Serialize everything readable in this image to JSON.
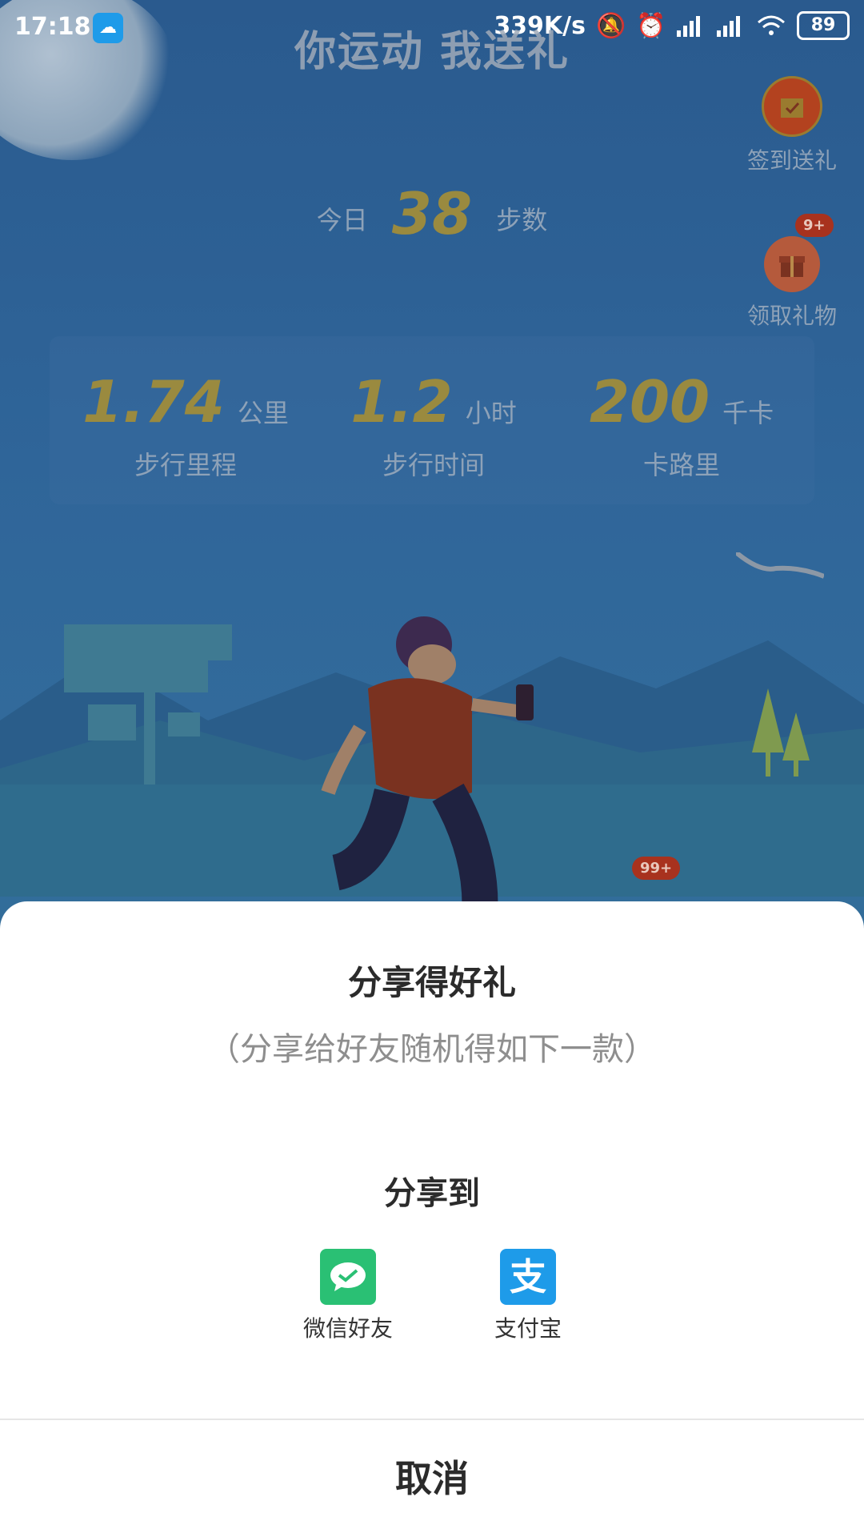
{
  "status_bar": {
    "time": "17:18",
    "network_speed": "339K/s",
    "battery": "89"
  },
  "page": {
    "title": "你运动 我送礼",
    "side_buttons": {
      "checkin_label": "签到送礼",
      "gift_label": "领取礼物",
      "gift_badge": "9+",
      "bottom_badge": "99+"
    },
    "today": {
      "prefix": "今日",
      "steps": "38",
      "suffix": "步数"
    },
    "stats": [
      {
        "value": "1.74",
        "unit": "公里",
        "label": "步行里程"
      },
      {
        "value": "1.2",
        "unit": "小时",
        "label": "步行时间"
      },
      {
        "value": "200",
        "unit": "千卡",
        "label": "卡路里"
      }
    ]
  },
  "share_sheet": {
    "title": "分享得好礼",
    "subtitle": "（分享给好友随机得如下一款）",
    "share_to": "分享到",
    "options": [
      {
        "label": "微信好友",
        "icon": "wechat-icon",
        "color": "#2ac074"
      },
      {
        "label": "支付宝",
        "icon": "alipay-icon",
        "color": "#1e9be9"
      }
    ],
    "cancel": "取消"
  }
}
